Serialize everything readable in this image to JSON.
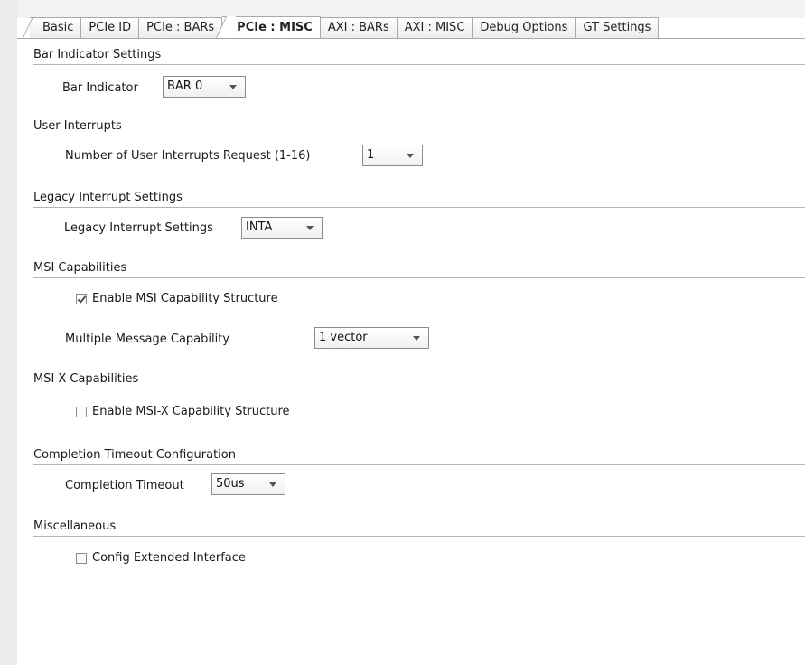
{
  "tabs": [
    {
      "label": "Basic"
    },
    {
      "label": "PCIe ID"
    },
    {
      "label": "PCIe : BARs"
    },
    {
      "label": "PCIe : MISC"
    },
    {
      "label": "AXI : BARs"
    },
    {
      "label": "AXI : MISC"
    },
    {
      "label": "Debug Options"
    },
    {
      "label": "GT Settings"
    }
  ],
  "active_tab": "PCIe : MISC",
  "bar_indicator": {
    "title": "Bar Indicator Settings",
    "label": "Bar Indicator",
    "value": "BAR 0"
  },
  "user_interrupts": {
    "title": "User Interrupts",
    "label": "Number of User Interrupts Request (1-16)",
    "value": "1"
  },
  "legacy_interrupts": {
    "title": "Legacy Interrupt Settings",
    "label": "Legacy Interrupt Settings",
    "value": "INTA"
  },
  "msi": {
    "title": "MSI Capabilities",
    "enable_label": "Enable MSI Capability Structure",
    "enable_checked": true,
    "mmc_label": "Multiple Message Capability",
    "mmc_value": "1 vector"
  },
  "msix": {
    "title": "MSI-X Capabilities",
    "enable_label": "Enable MSI-X Capability Structure",
    "enable_checked": false
  },
  "completion_timeout": {
    "title": "Completion Timeout Configuration",
    "label": "Completion Timeout",
    "value": "50us"
  },
  "misc": {
    "title": "Miscellaneous",
    "config_ext_label": "Config Extended Interface",
    "config_ext_checked": false
  }
}
